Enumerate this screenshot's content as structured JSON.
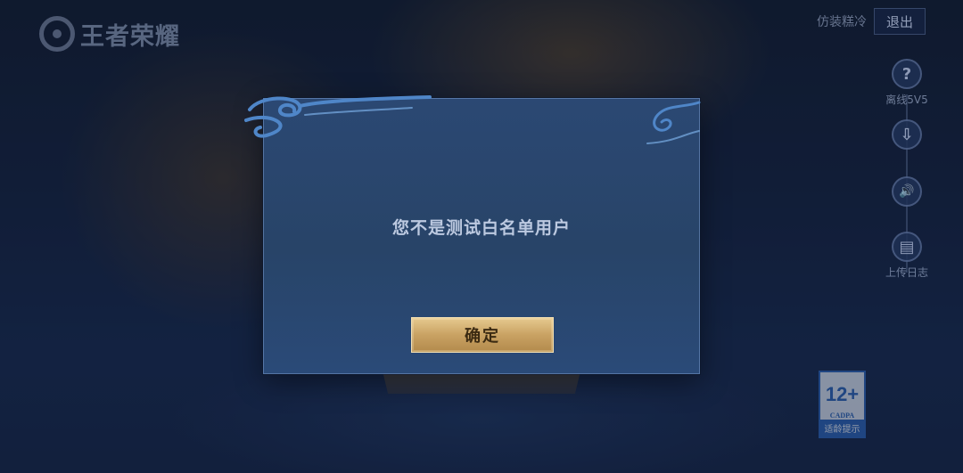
{
  "app": {
    "logo_text": "王者荣耀"
  },
  "header": {
    "username": "仿装糕冷",
    "logout_label": "退出"
  },
  "side_menu": {
    "items": [
      {
        "icon": "question-icon",
        "glyph": "?",
        "label": "离线5V5"
      },
      {
        "icon": "download-icon",
        "glyph": "⇩",
        "label": ""
      },
      {
        "icon": "speaker-icon",
        "glyph": "🔊",
        "label": ""
      },
      {
        "icon": "clipboard-icon",
        "glyph": "▤",
        "label": "上传日志"
      }
    ]
  },
  "age_rating": {
    "age": "12+",
    "org": "CADPA",
    "tip": "适龄提示"
  },
  "dialog": {
    "message": "您不是测试白名单用户",
    "confirm_label": "确定"
  },
  "colors": {
    "dialog_bg": "#284468",
    "button_gold": "#c9a263",
    "rating_blue": "#2b64b8"
  }
}
